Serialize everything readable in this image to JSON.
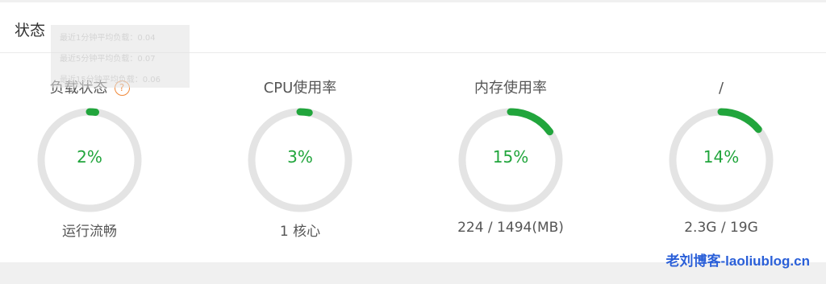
{
  "panel": {
    "title": "状态"
  },
  "tooltip": {
    "lines": [
      "最近1分钟平均负载：0.04",
      "最近5分钟平均负载：0.07",
      "最近15分钟平均负载：0.06"
    ]
  },
  "colors": {
    "accent": "#21a53c",
    "track": "#e4e4e4",
    "help": "#f0883a"
  },
  "gauges": [
    {
      "title": "负载状态",
      "help_icon": "question-mark",
      "percent": 2,
      "value_label": "2%",
      "subtitle": "运行流畅"
    },
    {
      "title": "CPU使用率",
      "percent": 3,
      "value_label": "3%",
      "subtitle": "1 核心"
    },
    {
      "title": "内存使用率",
      "percent": 15,
      "value_label": "15%",
      "subtitle": "224 / 1494(MB)"
    },
    {
      "title": "/",
      "percent": 14,
      "value_label": "14%",
      "subtitle": "2.3G / 19G"
    }
  ],
  "watermark": "老刘博客-laoliublog.cn"
}
